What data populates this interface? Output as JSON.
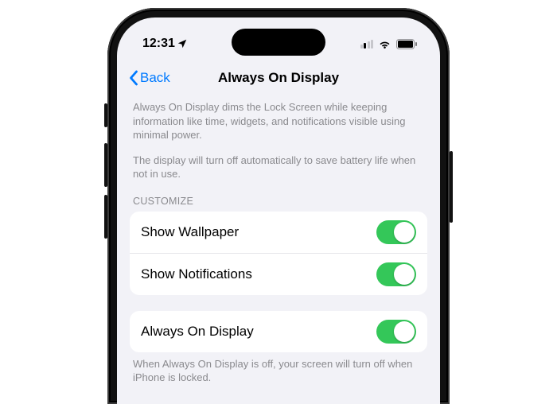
{
  "status": {
    "time": "12:31"
  },
  "nav": {
    "back_label": "Back",
    "title": "Always On Display"
  },
  "description": {
    "p1": "Always On Display dims the Lock Screen while keeping information like time, widgets, and notifications visible using minimal power.",
    "p2": "The display will turn off automatically to save battery life when not in use."
  },
  "sections": {
    "customize_header": "CUSTOMIZE",
    "customize": [
      {
        "label": "Show Wallpaper",
        "on": true
      },
      {
        "label": "Show Notifications",
        "on": true
      }
    ],
    "main": [
      {
        "label": "Always On Display",
        "on": true
      }
    ],
    "footer": "When Always On Display is off, your screen will turn off when iPhone is locked."
  },
  "colors": {
    "accent": "#007aff",
    "toggle_on": "#34c759",
    "bg": "#f2f2f7"
  }
}
